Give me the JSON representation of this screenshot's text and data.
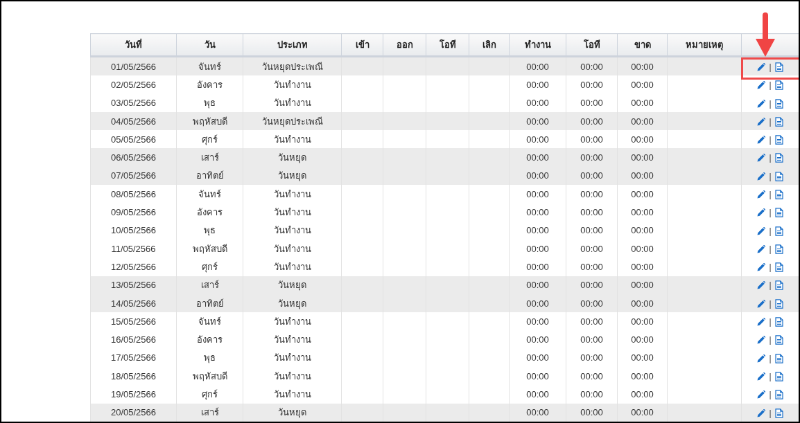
{
  "table": {
    "columns": [
      "วันที่",
      "วัน",
      "ประเภท",
      "เข้า",
      "ออก",
      "โอที",
      "เลิก",
      "ทำงาน",
      "โอที",
      "ขาด",
      "หมายเหตุ"
    ],
    "rows": [
      {
        "date": "01/05/2566",
        "day": "จันทร์",
        "type": "วันหยุดประเพณี",
        "work": "00:00",
        "ot": "00:00",
        "absent": "00:00",
        "separator": "|",
        "highlighted": true
      },
      {
        "date": "02/05/2566",
        "day": "อังคาร",
        "type": "วันทำงาน",
        "work": "00:00",
        "ot": "00:00",
        "absent": "00:00",
        "separator": "|",
        "highlighted": false
      },
      {
        "date": "03/05/2566",
        "day": "พุธ",
        "type": "วันทำงาน",
        "work": "00:00",
        "ot": "00:00",
        "absent": "00:00",
        "separator": "|",
        "highlighted": false
      },
      {
        "date": "04/05/2566",
        "day": "พฤหัสบดี",
        "type": "วันหยุดประเพณี",
        "work": "00:00",
        "ot": "00:00",
        "absent": "00:00",
        "separator": "|",
        "highlighted": true
      },
      {
        "date": "05/05/2566",
        "day": "ศุกร์",
        "type": "วันทำงาน",
        "work": "00:00",
        "ot": "00:00",
        "absent": "00:00",
        "separator": "|",
        "highlighted": false
      },
      {
        "date": "06/05/2566",
        "day": "เสาร์",
        "type": "วันหยุด",
        "work": "00:00",
        "ot": "00:00",
        "absent": "00:00",
        "separator": "|",
        "highlighted": true
      },
      {
        "date": "07/05/2566",
        "day": "อาทิตย์",
        "type": "วันหยุด",
        "work": "00:00",
        "ot": "00:00",
        "absent": "00:00",
        "separator": "|",
        "highlighted": true
      },
      {
        "date": "08/05/2566",
        "day": "จันทร์",
        "type": "วันทำงาน",
        "work": "00:00",
        "ot": "00:00",
        "absent": "00:00",
        "separator": "|",
        "highlighted": false
      },
      {
        "date": "09/05/2566",
        "day": "อังคาร",
        "type": "วันทำงาน",
        "work": "00:00",
        "ot": "00:00",
        "absent": "00:00",
        "separator": "|",
        "highlighted": false
      },
      {
        "date": "10/05/2566",
        "day": "พุธ",
        "type": "วันทำงาน",
        "work": "00:00",
        "ot": "00:00",
        "absent": "00:00",
        "separator": "|",
        "highlighted": false
      },
      {
        "date": "11/05/2566",
        "day": "พฤหัสบดี",
        "type": "วันทำงาน",
        "work": "00:00",
        "ot": "00:00",
        "absent": "00:00",
        "separator": "|",
        "highlighted": false
      },
      {
        "date": "12/05/2566",
        "day": "ศุกร์",
        "type": "วันทำงาน",
        "work": "00:00",
        "ot": "00:00",
        "absent": "00:00",
        "separator": "|",
        "highlighted": false
      },
      {
        "date": "13/05/2566",
        "day": "เสาร์",
        "type": "วันหยุด",
        "work": "00:00",
        "ot": "00:00",
        "absent": "00:00",
        "separator": "|",
        "highlighted": true
      },
      {
        "date": "14/05/2566",
        "day": "อาทิตย์",
        "type": "วันหยุด",
        "work": "00:00",
        "ot": "00:00",
        "absent": "00:00",
        "separator": "|",
        "highlighted": true
      },
      {
        "date": "15/05/2566",
        "day": "จันทร์",
        "type": "วันทำงาน",
        "work": "00:00",
        "ot": "00:00",
        "absent": "00:00",
        "separator": "|",
        "highlighted": false
      },
      {
        "date": "16/05/2566",
        "day": "อังคาร",
        "type": "วันทำงาน",
        "work": "00:00",
        "ot": "00:00",
        "absent": "00:00",
        "separator": "|",
        "highlighted": false
      },
      {
        "date": "17/05/2566",
        "day": "พุธ",
        "type": "วันทำงาน",
        "work": "00:00",
        "ot": "00:00",
        "absent": "00:00",
        "separator": "|",
        "highlighted": false
      },
      {
        "date": "18/05/2566",
        "day": "พฤหัสบดี",
        "type": "วันทำงาน",
        "work": "00:00",
        "ot": "00:00",
        "absent": "00:00",
        "separator": "|",
        "highlighted": false
      },
      {
        "date": "19/05/2566",
        "day": "ศุกร์",
        "type": "วันทำงาน",
        "work": "00:00",
        "ot": "00:00",
        "absent": "00:00",
        "separator": "|",
        "highlighted": false
      },
      {
        "date": "20/05/2566",
        "day": "เสาร์",
        "type": "วันหยุด",
        "work": "00:00",
        "ot": "00:00",
        "absent": "00:00",
        "separator": "|",
        "highlighted": true
      }
    ]
  }
}
